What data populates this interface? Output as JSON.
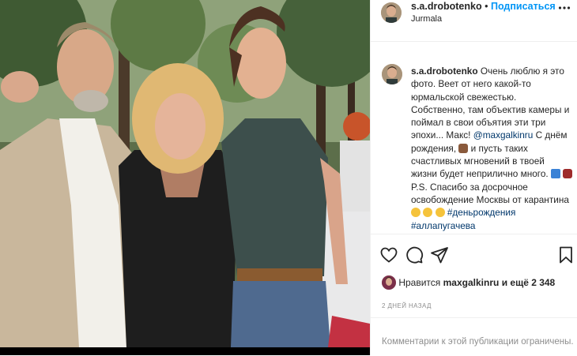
{
  "post": {
    "username": "s.a.drobotenko",
    "separator": "•",
    "follow_label": "Подписаться",
    "location": "Jurmala"
  },
  "caption": {
    "username": "s.a.drobotenko",
    "text_1": "Очень люблю я это фото. Веет от него какой-то юрмальской свежестью. Собственно, там объектив камеры и поймал в свои объятия эти три эпохи... Макс!",
    "mention": "@maxgalkinru",
    "text_2": "С днём рождения,",
    "text_3": "и пусть таких счастливых мгновений в твоей жизни будет неприлично много.",
    "text_4": "P.S. Спасибо за досрочное освобождение Москвы от карантина",
    "hashtags": "#деньрождения #аллапугачева"
  },
  "likes": {
    "prefix": "Нравится",
    "user": "maxgalkinru",
    "suffix": "и ещё 2 348"
  },
  "timestamp": "2 ДНЕЙ НАЗАД",
  "comments_notice": "Комментарии к этой публикации ограничены.",
  "icons": {
    "more": "more-horizontal-icon",
    "like": "heart-icon",
    "comment": "comment-icon",
    "share": "share-icon",
    "save": "bookmark-icon"
  },
  "colors": {
    "follow": "#0095f6",
    "link": "#00376b",
    "text": "#262626",
    "muted": "#8e8e8e"
  }
}
